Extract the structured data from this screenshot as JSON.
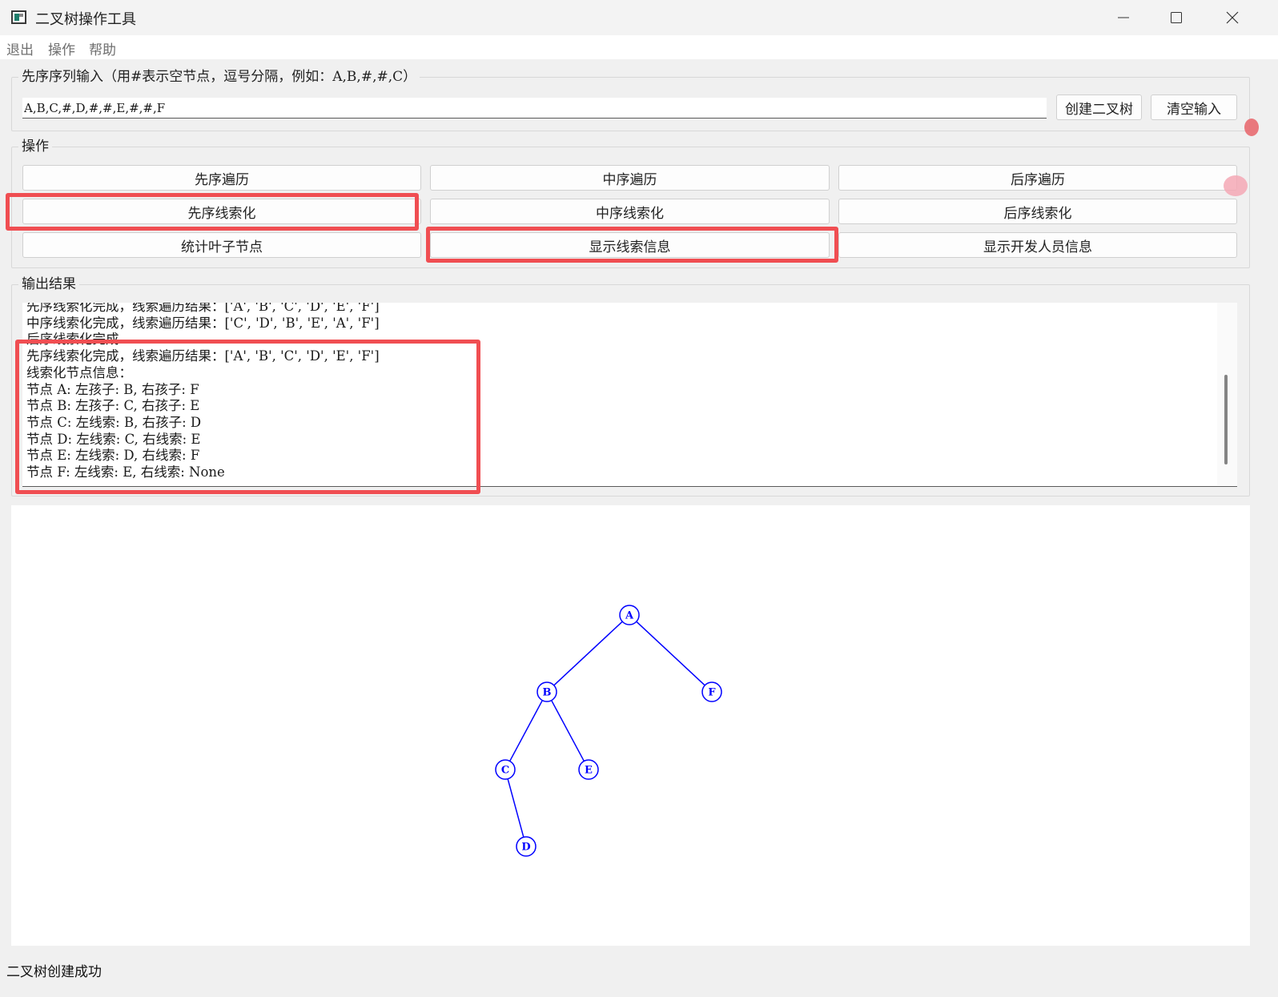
{
  "window": {
    "title": "二叉树操作工具",
    "controls": [
      "minimize",
      "maximize",
      "close"
    ]
  },
  "menu": [
    "退出",
    "操作",
    "帮助"
  ],
  "input_group": {
    "title": "先序序列输入（用#表示空节点，逗号分隔，例如：A,B,#,#,C）",
    "value": "A,B,C,#,D,#,#,E,#,#,F",
    "create_button": "创建二叉树",
    "clear_button": "清空输入"
  },
  "ops_group": {
    "title": "操作",
    "buttons": [
      "先序遍历",
      "中序遍历",
      "后序遍历",
      "先序线索化",
      "中序线索化",
      "后序线索化",
      "统计叶子节点",
      "显示线索信息",
      "显示开发人员信息"
    ]
  },
  "output_group": {
    "title": "输出结果",
    "lines": [
      "先序线索化完成，线索遍历结果：['A', 'B', 'C', 'D', 'E', 'F']",
      "中序线索化完成，线索遍历结果：['C', 'D', 'B', 'E', 'A', 'F']",
      "后序线索化完成",
      "先序线索化完成，线索遍历结果：['A', 'B', 'C', 'D', 'E', 'F']",
      "线索化节点信息：",
      "节点 A: 左孩子: B, 右孩子: F",
      "节点 B: 左孩子: C, 右孩子: E",
      "节点 C: 左线索: B, 右孩子: D",
      "节点 D: 左线索: C, 右线索: E",
      "节点 E: 左线索: D, 右线索: F",
      "节点 F: 左线索: E, 右线索: None"
    ]
  },
  "tree": {
    "nodes": [
      "A",
      "B",
      "F",
      "C",
      "E",
      "D"
    ],
    "edges": [
      [
        "A",
        "B"
      ],
      [
        "A",
        "F"
      ],
      [
        "B",
        "C"
      ],
      [
        "B",
        "E"
      ],
      [
        "C",
        "D"
      ]
    ],
    "color": "#0000ff"
  },
  "status_bar": "二叉树创建成功",
  "colors": {
    "highlight": "#f04e52",
    "background": "#f0f0f0"
  }
}
